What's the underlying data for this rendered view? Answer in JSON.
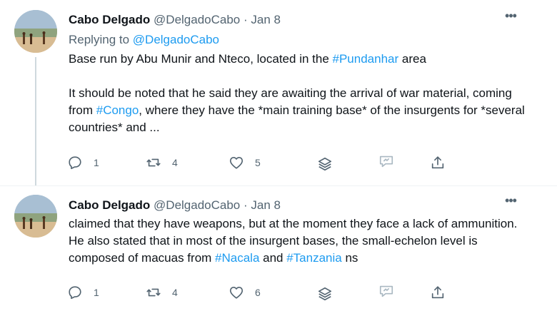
{
  "tweets": [
    {
      "author": {
        "name": "Cabo Delgado",
        "handle": "@DelgadoCabo"
      },
      "separator": "·",
      "date": "Jan 8",
      "more_label": "•••",
      "reply": {
        "prefix": "Replying to ",
        "handle": "@DelgadoCabo"
      },
      "text": {
        "p1": {
          "a": "Base run by Abu Munir and Nteco, located in the ",
          "tag": "#Pundanhar",
          "b": " area"
        },
        "p2": {
          "a": "It should be noted that he said they are awaiting the arrival of war material, coming from ",
          "tag": "#Congo",
          "b": ", where they have the *main training base* of the insurgents for *several countries* and ..."
        }
      },
      "actions": {
        "replies": "1",
        "retweets": "4",
        "likes": "5"
      }
    },
    {
      "author": {
        "name": "Cabo Delgado",
        "handle": "@DelgadoCabo"
      },
      "separator": "·",
      "date": "Jan 8",
      "more_label": "•••",
      "text": {
        "a": "claimed that they have weapons, but at the moment they face a lack of ammunition.  He also stated that in most of the insurgent bases, the small-echelon level is composed of macuas from ",
        "tag1": "#Nacala",
        "mid": " and ",
        "tag2": "#Tanzania",
        "b": " ns"
      },
      "actions": {
        "replies": "1",
        "retweets": "4",
        "likes": "6"
      }
    }
  ],
  "colors": {
    "link": "#1d9bf0",
    "muted": "#536471",
    "text": "#0f1419",
    "thread_line": "#cfd9de"
  },
  "icons": [
    "reply-icon",
    "retweet-icon",
    "like-icon",
    "layers-icon",
    "chat-icon",
    "share-icon",
    "more-icon"
  ]
}
